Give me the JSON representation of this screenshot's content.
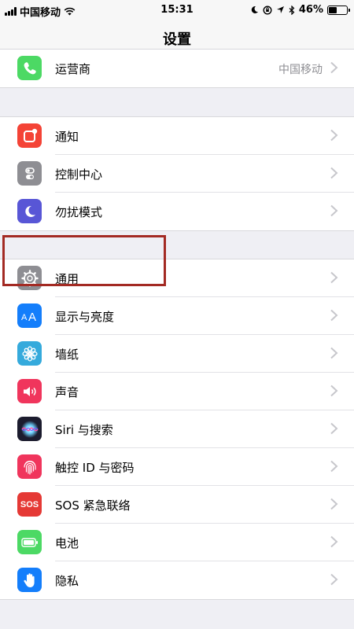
{
  "status_bar": {
    "carrier": "中国移动",
    "time": "15:31",
    "battery": "46%",
    "battery_level": 0.46
  },
  "nav": {
    "title": "设置"
  },
  "groups": [
    {
      "rows": [
        {
          "label": "运营商",
          "value": "中国移动",
          "icon": "phone-icon",
          "color": "#4cd964"
        }
      ]
    },
    {
      "rows": [
        {
          "label": "通知",
          "icon": "notification-icon",
          "color": "#f44336"
        },
        {
          "label": "控制中心",
          "icon": "control-center-icon",
          "color": "#8e8e93"
        },
        {
          "label": "勿扰模式",
          "icon": "moon-icon",
          "color": "#5856d6"
        }
      ]
    },
    {
      "rows": [
        {
          "label": "通用",
          "icon": "gear-icon",
          "color": "#8e8e93"
        },
        {
          "label": "显示与亮度",
          "icon": "display-aa-icon",
          "color": "#147efb"
        },
        {
          "label": "墙纸",
          "icon": "flower-icon",
          "color": "#35aadc"
        },
        {
          "label": "声音",
          "icon": "speaker-icon",
          "color": "#f0355c"
        },
        {
          "label": "Siri 与搜索",
          "icon": "siri-icon",
          "color": "#1c1c2e"
        },
        {
          "label": "触控 ID 与密码",
          "icon": "fingerprint-icon",
          "color": "#f0355c"
        },
        {
          "label": "SOS 紧急联络",
          "icon": "sos-icon",
          "color": "#e53935",
          "icon_text": "SOS"
        },
        {
          "label": "电池",
          "icon": "battery-icon",
          "color": "#4cd964"
        },
        {
          "label": "隐私",
          "icon": "hand-icon",
          "color": "#147efb"
        }
      ]
    }
  ]
}
